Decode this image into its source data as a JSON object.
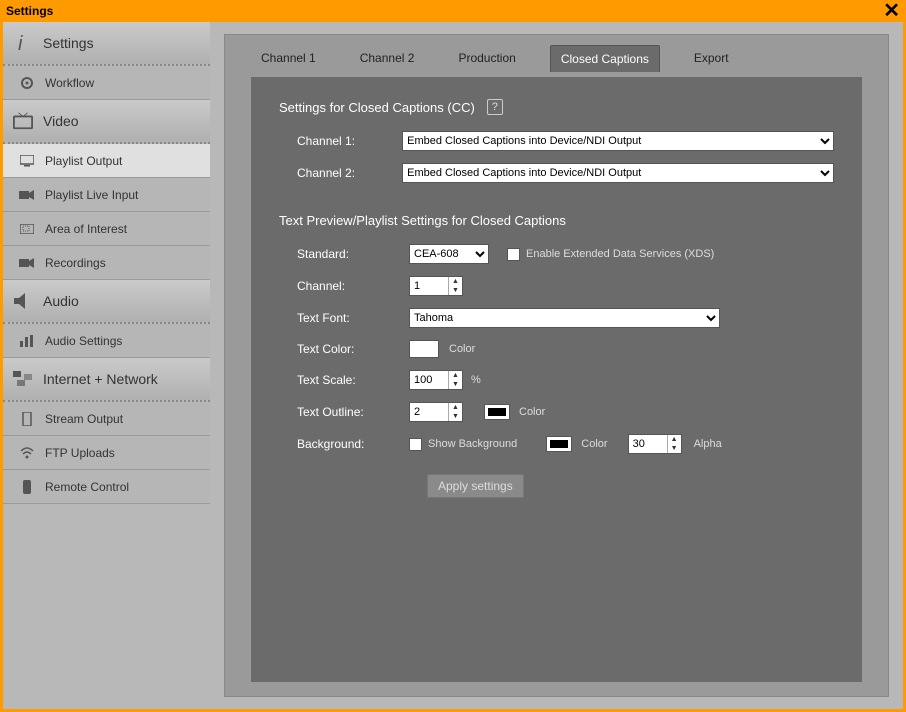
{
  "window": {
    "title": "Settings"
  },
  "sidebar": {
    "sections": [
      {
        "label": "Settings",
        "items": [
          {
            "label": "Workflow"
          }
        ]
      },
      {
        "label": "Video",
        "items": [
          {
            "label": "Playlist Output",
            "active": true
          },
          {
            "label": "Playlist Live Input"
          },
          {
            "label": "Area of Interest"
          },
          {
            "label": "Recordings"
          }
        ]
      },
      {
        "label": "Audio",
        "items": [
          {
            "label": "Audio Settings"
          }
        ]
      },
      {
        "label": "Internet + Network",
        "items": [
          {
            "label": "Stream Output"
          },
          {
            "label": "FTP Uploads"
          },
          {
            "label": "Remote Control"
          }
        ]
      }
    ]
  },
  "tabs": [
    "Channel 1",
    "Channel 2",
    "Production",
    "Closed Captions",
    "Export"
  ],
  "active_tab": "Closed Captions",
  "cc": {
    "heading": "Settings for Closed Captions (CC)",
    "channel1_label": "Channel 1:",
    "channel2_label": "Channel 2:",
    "channel1_value": "Embed Closed Captions into Device/NDI Output",
    "channel2_value": "Embed Closed Captions into Device/NDI Output",
    "preview_heading": "Text Preview/Playlist Settings for Closed Captions",
    "standard_label": "Standard:",
    "standard_value": "CEA-608",
    "xds_label": "Enable Extended Data Services (XDS)",
    "channel_label": "Channel:",
    "channel_value": "1",
    "font_label": "Text Font:",
    "font_value": "Tahoma",
    "textcolor_label": "Text Color:",
    "color_word": "Color",
    "scale_label": "Text Scale:",
    "scale_value": "100",
    "percent": "%",
    "outline_label": "Text Outline:",
    "outline_value": "2",
    "background_label": "Background:",
    "showbg_label": "Show Background",
    "alpha_value": "30",
    "alpha_label": "Alpha",
    "apply_label": "Apply settings"
  }
}
